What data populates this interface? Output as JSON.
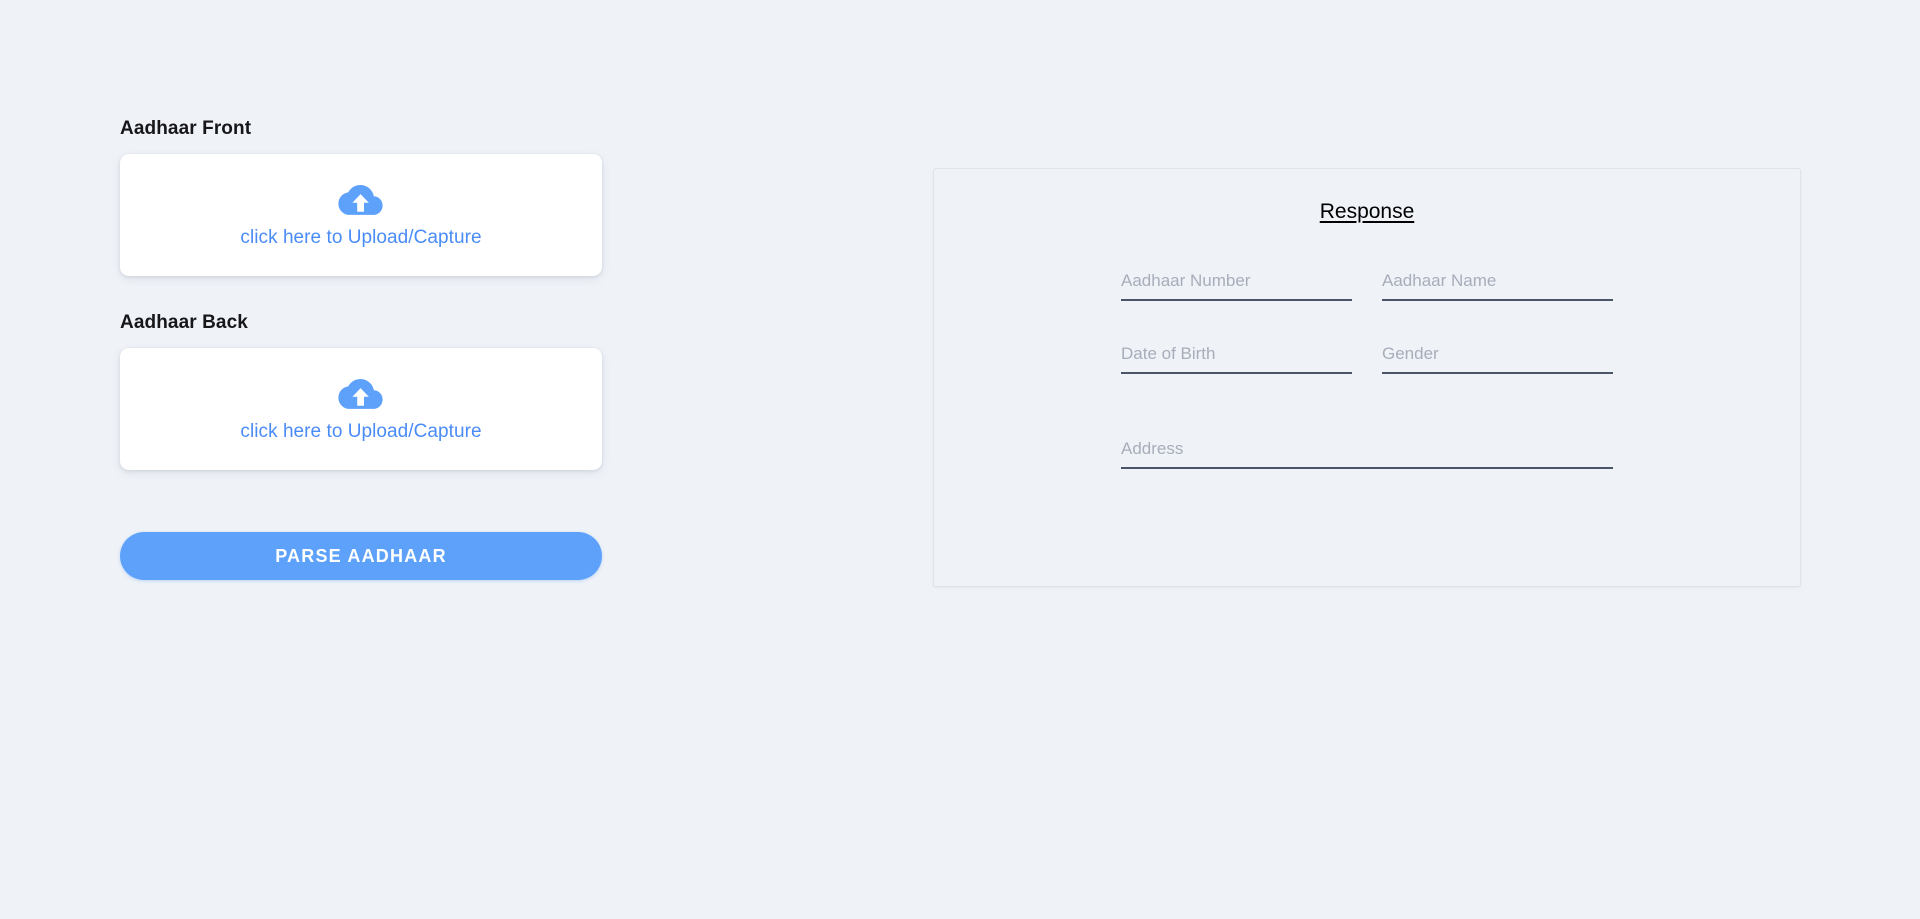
{
  "theme": {
    "page_background": "#eff2f7",
    "card_background": "#ffffff",
    "link_blue": "#4a8cf7",
    "button_blue": "#5da1fa",
    "underline_color": "#4a5568",
    "placeholder_color": "#a7adba",
    "heading_color": "#17171a"
  },
  "upload_section": {
    "front": {
      "label": "Aadhaar Front",
      "upload_text": "click here to Upload/Capture",
      "icon": "cloud-upload-icon"
    },
    "back": {
      "label": "Aadhaar Back",
      "upload_text": "click here to Upload/Capture",
      "icon": "cloud-upload-icon"
    },
    "submit_label": "PARSE AADHAAR"
  },
  "response_panel": {
    "title": "Response",
    "fields": [
      {
        "name": "aadhaar-number",
        "placeholder": "Aadhaar Number",
        "value": ""
      },
      {
        "name": "aadhaar-name",
        "placeholder": "Aadhaar Name",
        "value": ""
      },
      {
        "name": "date-of-birth",
        "placeholder": "Date of Birth",
        "value": ""
      },
      {
        "name": "gender",
        "placeholder": "Gender",
        "value": ""
      },
      {
        "name": "address",
        "placeholder": "Address",
        "value": ""
      }
    ]
  }
}
